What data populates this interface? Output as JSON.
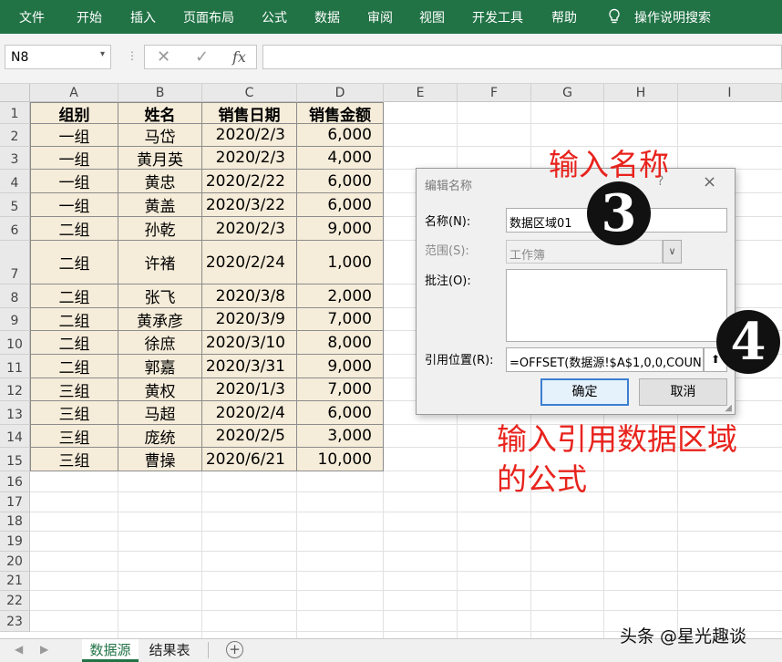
{
  "ribbon": {
    "tabs": [
      "文件",
      "开始",
      "插入",
      "页面布局",
      "公式",
      "数据",
      "审阅",
      "视图",
      "开发工具",
      "帮助"
    ],
    "search_label": "操作说明搜索"
  },
  "formula_bar": {
    "name_box": "N8",
    "fx_label": "fx",
    "formula": ""
  },
  "columns": [
    "A",
    "B",
    "C",
    "D",
    "E",
    "F",
    "G",
    "H",
    "I"
  ],
  "rows": [
    "1",
    "2",
    "3",
    "4",
    "5",
    "6",
    "7",
    "8",
    "9",
    "10",
    "11",
    "12",
    "13",
    "14",
    "15",
    "16",
    "17",
    "18",
    "19",
    "20",
    "21",
    "22",
    "23"
  ],
  "table": {
    "headers": [
      "组别",
      "姓名",
      "销售日期",
      "销售金额"
    ],
    "rows": [
      [
        "一组",
        "马岱",
        "2020/2/3",
        "6,000"
      ],
      [
        "一组",
        "黄月英",
        "2020/2/3",
        "4,000"
      ],
      [
        "一组",
        "黄忠",
        "2020/2/22",
        "6,000"
      ],
      [
        "一组",
        "黄盖",
        "2020/3/22",
        "6,000"
      ],
      [
        "二组",
        "孙乾",
        "2020/2/3",
        "9,000"
      ],
      [
        "二组",
        "许褚",
        "2020/2/24",
        "1,000"
      ],
      [
        "二组",
        "张飞",
        "2020/3/8",
        "2,000"
      ],
      [
        "二组",
        "黄承彦",
        "2020/3/9",
        "7,000"
      ],
      [
        "二组",
        "徐庶",
        "2020/3/10",
        "8,000"
      ],
      [
        "二组",
        "郭嘉",
        "2020/3/31",
        "9,000"
      ],
      [
        "三组",
        "黄权",
        "2020/1/3",
        "7,000"
      ],
      [
        "三组",
        "马超",
        "2020/2/4",
        "6,000"
      ],
      [
        "三组",
        "庞统",
        "2020/2/5",
        "3,000"
      ],
      [
        "三组",
        "曹操",
        "2020/6/21",
        "10,000"
      ]
    ]
  },
  "dialog": {
    "title": "编辑名称",
    "help_glyph": "?",
    "close_glyph": "×",
    "name_label": "名称(N):",
    "name_value": "数据区域01",
    "scope_label": "范围(S):",
    "scope_value": "工作簿",
    "comment_label": "批注(O):",
    "comment_value": "",
    "ref_label": "引用位置(R):",
    "ref_value": "=OFFSET(数据源!$A$1,0,0,COUN",
    "ok_label": "确定",
    "cancel_label": "取消"
  },
  "annotations": {
    "step3_badge": "❸",
    "step3_text": "输入名称",
    "step4_badge": "❹",
    "step4_line1": "输入引用数据区域",
    "step4_line2": "的公式"
  },
  "sheets": {
    "tabs": [
      "数据源",
      "结果表"
    ],
    "active": "数据源",
    "add_glyph": "+"
  },
  "watermark": "头条 @星光趣谈",
  "colors": {
    "ribbon": "#217346",
    "table_fill": "#f5ecd9",
    "annotation": "#e8231d"
  },
  "icons": [
    "lightbulb-icon",
    "dropdown-arrow-icon",
    "cancel-x-icon",
    "check-icon",
    "fx-icon",
    "collapse-dialog-icon",
    "scroll-left-icon",
    "scroll-right-icon",
    "add-sheet-icon"
  ]
}
